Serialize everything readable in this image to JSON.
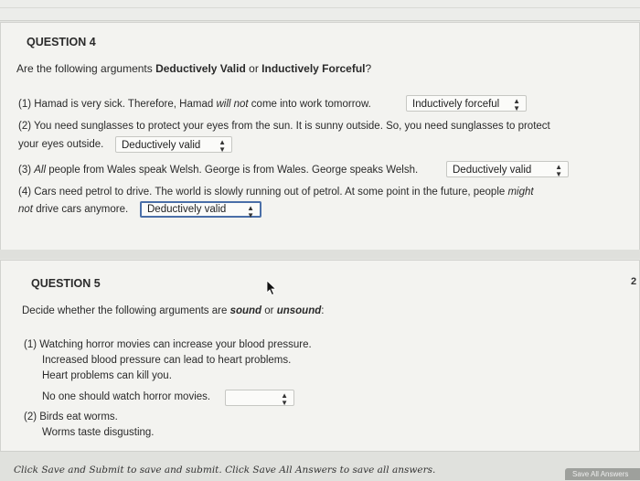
{
  "q4": {
    "number": "QUESTION 4",
    "prompt_pre": "Are the following arguments ",
    "prompt_b1": "Deductively Valid",
    "prompt_mid": " or ",
    "prompt_b2": "Inductively Forceful",
    "prompt_end": "?",
    "items": [
      {
        "p1": "(1) Hamad is very sick. Therefore, Hamad ",
        "em": "will not",
        "p2": " come into work tomorrow.",
        "answer": "Inductively forceful"
      },
      {
        "line1": "(2) You need sunglasses to protect your eyes from the sun.  It is sunny outside.  So, you need sunglasses to protect",
        "line2": "your eyes outside.",
        "answer": "Deductively valid"
      },
      {
        "p1": "(3) ",
        "em": "All",
        "p2": " people from Wales speak Welsh.  George is from Wales.  George speaks Welsh.",
        "answer": "Deductively valid"
      },
      {
        "line1": "(4) Cars need petrol to drive.  The world is slowly running out of petrol.  At some point in the future, people ",
        "em": "might",
        "line2": "not",
        "line2b": " drive cars anymore.",
        "answer": "Deductively valid"
      }
    ]
  },
  "q5": {
    "number": "QUESTION 5",
    "prompt_pre": "Decide whether the following arguments are ",
    "prompt_b1": "sound",
    "prompt_mid": " or ",
    "prompt_b2": "unsound",
    "prompt_end": ":",
    "arg1": {
      "line1": "(1) Watching horror movies can increase your blood pressure.",
      "line2": "Increased blood pressure can lead to heart problems.",
      "line3": "Heart problems can kill you.",
      "line4": "No one should watch horror movies.",
      "answer": ""
    },
    "arg2": {
      "line1": "(2) Birds eat worms.",
      "line2": "Worms taste disgusting."
    }
  },
  "side_badge": "2",
  "footer": {
    "message": "Click Save and Submit to save and submit. Click Save All Answers to save all answers.",
    "save_all": "Save All Answers"
  }
}
